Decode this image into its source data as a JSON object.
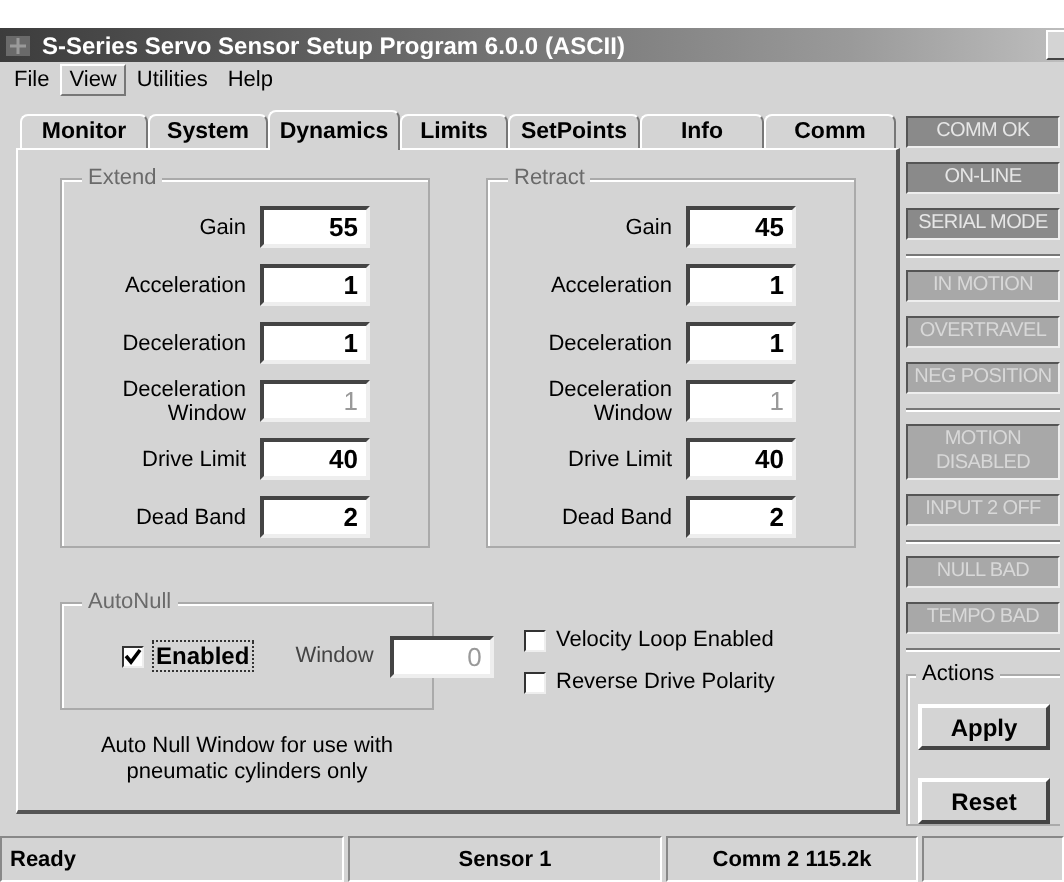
{
  "window": {
    "title": "S-Series Servo Sensor Setup Program 6.0.0 (ASCII)"
  },
  "menu": [
    {
      "label": "File",
      "selected": false
    },
    {
      "label": "View",
      "selected": true
    },
    {
      "label": "Utilities",
      "selected": false
    },
    {
      "label": "Help",
      "selected": false
    }
  ],
  "tabs": [
    {
      "label": "Monitor",
      "selected": false
    },
    {
      "label": "System",
      "selected": false
    },
    {
      "label": "Dynamics",
      "selected": true
    },
    {
      "label": "Limits",
      "selected": false
    },
    {
      "label": "SetPoints",
      "selected": false
    },
    {
      "label": "Info",
      "selected": false
    },
    {
      "label": "Comm",
      "selected": false
    }
  ],
  "groups": [
    {
      "title": "Extend",
      "fields": [
        {
          "label": "Gain",
          "value": "55",
          "disabled": false
        },
        {
          "label": "Acceleration",
          "value": "1",
          "disabled": false
        },
        {
          "label": "Deceleration",
          "value": "1",
          "disabled": false
        },
        {
          "label": "Deceleration\nWindow",
          "value": "1",
          "disabled": true
        },
        {
          "label": "Drive Limit",
          "value": "40",
          "disabled": false
        },
        {
          "label": "Dead Band",
          "value": "2",
          "disabled": false
        }
      ]
    },
    {
      "title": "Retract",
      "fields": [
        {
          "label": "Gain",
          "value": "45",
          "disabled": false
        },
        {
          "label": "Acceleration",
          "value": "1",
          "disabled": false
        },
        {
          "label": "Deceleration",
          "value": "1",
          "disabled": false
        },
        {
          "label": "Deceleration\nWindow",
          "value": "1",
          "disabled": true
        },
        {
          "label": "Drive Limit",
          "value": "40",
          "disabled": false
        },
        {
          "label": "Dead Band",
          "value": "2",
          "disabled": false
        }
      ]
    }
  ],
  "autonull": {
    "title": "AutoNull",
    "enabled": {
      "label": "Enabled",
      "checked": true
    },
    "window": {
      "label": "Window",
      "value": "0",
      "disabled": true
    }
  },
  "note": "Auto Null Window for use with\npneumatic cylinders only",
  "options": [
    {
      "label": "Velocity Loop Enabled",
      "checked": false
    },
    {
      "label": "Reverse Drive Polarity",
      "checked": false
    }
  ],
  "indicator_groups": [
    {
      "items": [
        {
          "label": "COMM OK",
          "on": true
        },
        {
          "label": "ON-LINE",
          "on": true
        },
        {
          "label": "SERIAL MODE",
          "on": true
        }
      ]
    },
    {
      "items": [
        {
          "label": "IN MOTION",
          "on": false
        },
        {
          "label": "OVERTRAVEL",
          "on": false
        },
        {
          "label": "NEG POSITION",
          "on": false
        }
      ]
    },
    {
      "items": [
        {
          "label": "MOTION\nDISABLED",
          "on": false
        },
        {
          "label": "INPUT 2 OFF",
          "on": false
        }
      ]
    },
    {
      "items": [
        {
          "label": "NULL BAD",
          "on": false
        },
        {
          "label": "TEMPO BAD",
          "on": false
        }
      ]
    }
  ],
  "actions": {
    "title": "Actions",
    "buttons": [
      "Apply",
      "Reset"
    ]
  },
  "status_bar": [
    "Ready",
    "Sensor 1",
    "Comm 2 115.2k"
  ]
}
